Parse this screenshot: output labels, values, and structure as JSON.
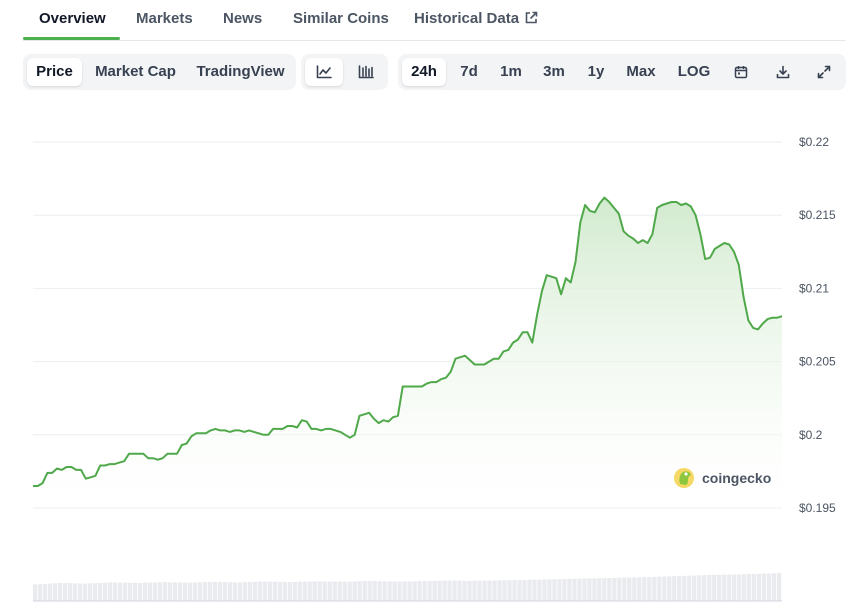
{
  "tabs": [
    {
      "label": "Overview"
    },
    {
      "label": "Markets"
    },
    {
      "label": "News"
    },
    {
      "label": "Similar Coins"
    },
    {
      "label": "Historical Data"
    }
  ],
  "toolbar": {
    "metrics": [
      "Price",
      "Market Cap",
      "TradingView"
    ],
    "selected_metric": "Price",
    "chart_views": [
      {
        "icon": "line-chart-icon"
      },
      {
        "icon": "candlestick-chart-icon"
      }
    ],
    "ranges": [
      "24h",
      "7d",
      "1m",
      "3m",
      "1y",
      "Max",
      "LOG"
    ],
    "selected_range": "24h",
    "icons": [
      "calendar-icon",
      "download-icon",
      "expand-icon"
    ]
  },
  "colors": {
    "accent": "#4caf50",
    "line": "#4fa84a",
    "fill": "#dcefd9"
  },
  "watermark": "coingecko",
  "chart_data": {
    "type": "area",
    "y_tick_labels": [
      "$0.22",
      "$0.215",
      "$0.21",
      "$0.205",
      "$0.2",
      "$0.195"
    ],
    "y_ticks": [
      0.22,
      0.215,
      0.21,
      0.205,
      0.2,
      0.195
    ],
    "ylim": [
      0.195,
      0.22
    ],
    "grid": true,
    "y": [
      0.1965,
      0.1965,
      0.1967,
      0.1974,
      0.1974,
      0.1977,
      0.1976,
      0.1978,
      0.1978,
      0.1976,
      0.1976,
      0.197,
      0.1971,
      0.1972,
      0.1979,
      0.1979,
      0.198,
      0.198,
      0.1981,
      0.1982,
      0.1987,
      0.1987,
      0.1987,
      0.1987,
      0.1984,
      0.1984,
      0.1983,
      0.1984,
      0.1987,
      0.1987,
      0.1987,
      0.1993,
      0.1994,
      0.1999,
      0.2001,
      0.2001,
      0.2001,
      0.2003,
      0.2004,
      0.2003,
      0.2003,
      0.2002,
      0.2003,
      0.2003,
      0.2002,
      0.2003,
      0.2002,
      0.2001,
      0.2,
      0.2,
      0.2004,
      0.2004,
      0.2004,
      0.2006,
      0.2006,
      0.2005,
      0.201,
      0.2009,
      0.2004,
      0.2004,
      0.2003,
      0.2004,
      0.2004,
      0.2003,
      0.2002,
      0.2,
      0.1998,
      0.2,
      0.2013,
      0.2014,
      0.2015,
      0.2011,
      0.2008,
      0.201,
      0.2009,
      0.2012,
      0.2013,
      0.2033,
      0.2033,
      0.2033,
      0.2033,
      0.2033,
      0.2035,
      0.2036,
      0.2036,
      0.2038,
      0.2039,
      0.2043,
      0.2052,
      0.2053,
      0.2054,
      0.2051,
      0.2048,
      0.2048,
      0.2048,
      0.205,
      0.2052,
      0.2052,
      0.2057,
      0.2058,
      0.2063,
      0.2065,
      0.207,
      0.207,
      0.2063,
      0.2082,
      0.2098,
      0.2109,
      0.2108,
      0.2107,
      0.2096,
      0.2107,
      0.2104,
      0.2118,
      0.2145,
      0.2157,
      0.2153,
      0.2152,
      0.2158,
      0.2162,
      0.2159,
      0.2155,
      0.2151,
      0.2139,
      0.2136,
      0.2134,
      0.2131,
      0.2133,
      0.2131,
      0.2137,
      0.2155,
      0.2157,
      0.2158,
      0.2159,
      0.2159,
      0.2157,
      0.2158,
      0.2156,
      0.215,
      0.2137,
      0.212,
      0.2121,
      0.2127,
      0.2129,
      0.2131,
      0.213,
      0.2125,
      0.2116,
      0.2094,
      0.2078,
      0.2073,
      0.2072,
      0.2076,
      0.2079,
      0.208,
      0.208,
      0.2081
    ],
    "volume_levels": [
      0.55,
      0.6,
      0.58,
      0.62,
      0.6,
      0.63,
      0.61,
      0.64,
      0.62,
      0.65,
      0.63,
      0.66,
      0.64,
      0.67,
      0.65,
      0.66,
      0.68,
      0.67,
      0.69,
      0.7,
      0.72,
      0.74,
      0.76,
      0.78,
      0.8,
      0.83,
      0.86,
      0.88,
      0.9,
      0.93
    ]
  }
}
